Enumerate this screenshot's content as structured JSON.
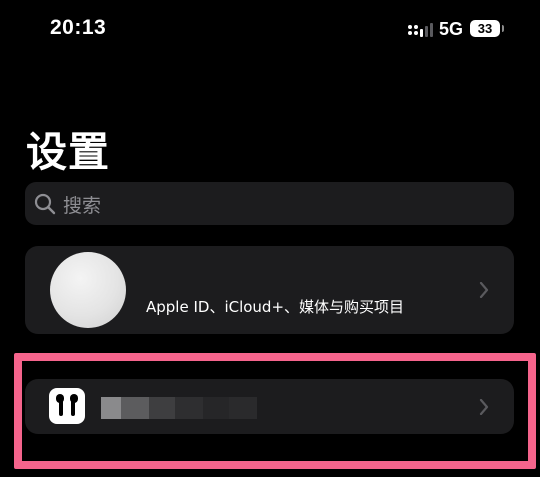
{
  "status_bar": {
    "time": "20:13",
    "network": "5G",
    "battery": "33",
    "signal_icon": "signal-bars-icon"
  },
  "header": {
    "title": "设置"
  },
  "search": {
    "placeholder": "搜索",
    "icon": "search-icon"
  },
  "account": {
    "subtitle": "Apple ID、iCloud+、媒体与购买项目",
    "avatar": "avatar"
  },
  "device": {
    "icon": "airpods-icon",
    "name_redacted": true
  },
  "colors": {
    "background": "#000000",
    "card": "#1c1c1e",
    "placeholder": "#8e8e93",
    "chevron": "#5a5a5e",
    "highlight": "#f5648c"
  }
}
